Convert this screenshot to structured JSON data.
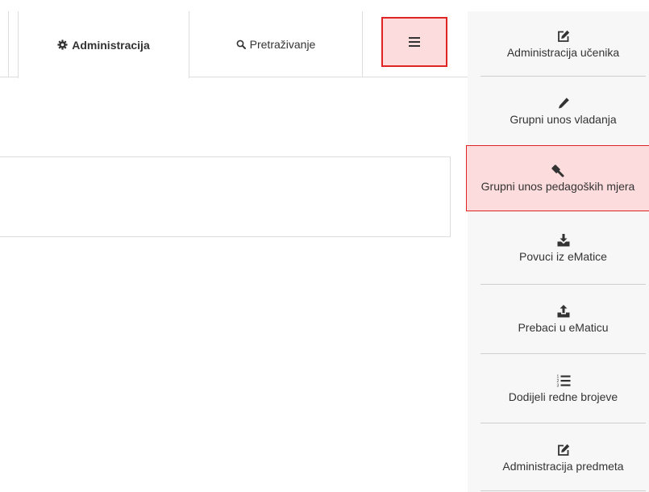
{
  "tabs": {
    "administracija_label": "Administracija",
    "pretrazivanje_label": "Pretraživanje"
  },
  "sidemenu": {
    "items": [
      {
        "label": "Administracija učenika",
        "icon": "edit-icon"
      },
      {
        "label": "Grupni unos vladanja",
        "icon": "pencil-icon"
      },
      {
        "label": "Grupni unos pedagoških mjera",
        "icon": "gavel-icon"
      },
      {
        "label": "Povuci iz eMatice",
        "icon": "download-icon"
      },
      {
        "label": "Prebaci u eMaticu",
        "icon": "upload-icon"
      },
      {
        "label": "Dodijeli redne brojeve",
        "icon": "ordered-list-icon"
      },
      {
        "label": "Administracija predmeta",
        "icon": "edit-icon"
      }
    ]
  },
  "colors": {
    "highlight_bg": "#fcdcdc",
    "highlight_border": "#e02424",
    "sidebar_bg": "#f7f7f7"
  }
}
